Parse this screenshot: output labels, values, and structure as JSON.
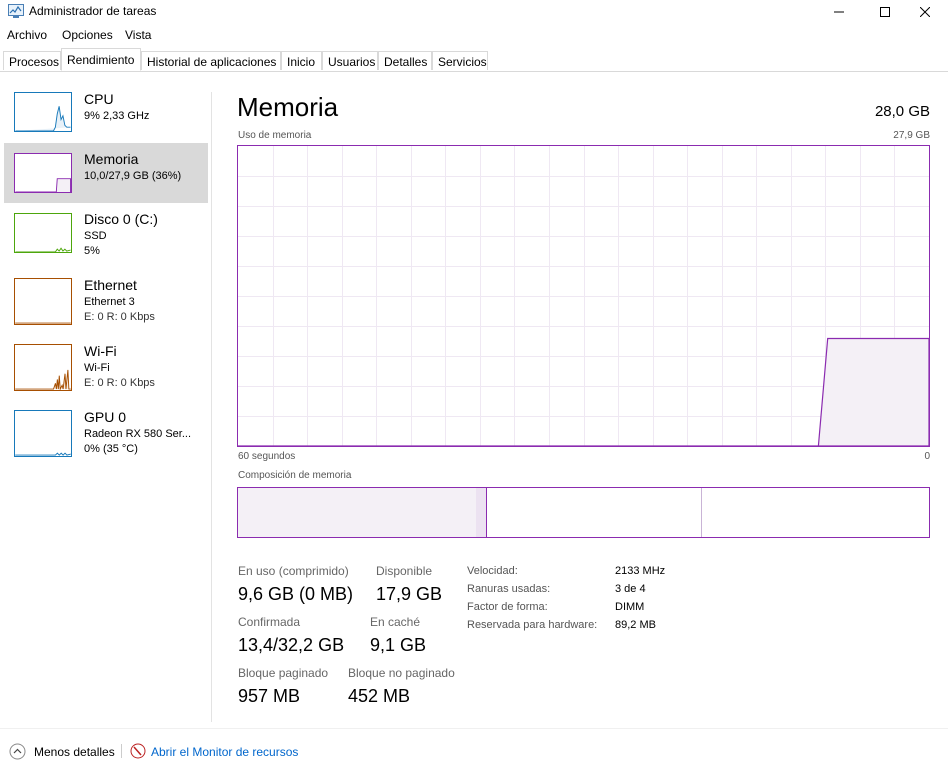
{
  "window": {
    "title": "Administrador de tareas"
  },
  "menu": [
    "Archivo",
    "Opciones",
    "Vista"
  ],
  "tabs": [
    "Procesos",
    "Rendimiento",
    "Historial de aplicaciones",
    "Inicio",
    "Usuarios",
    "Detalles",
    "Servicios"
  ],
  "active_tab": "Rendimiento",
  "sidebar": {
    "items": [
      {
        "name": "CPU",
        "sub1": "9%  2,33 GHz",
        "sub2": ""
      },
      {
        "name": "Memoria",
        "sub1": "10,0/27,9 GB (36%)",
        "sub2": ""
      },
      {
        "name": "Disco 0 (C:)",
        "sub1": "SSD",
        "sub2": "5%"
      },
      {
        "name": "Ethernet",
        "sub1": "Ethernet 3",
        "sub2": "E: 0  R: 0 Kbps"
      },
      {
        "name": "Wi-Fi",
        "sub1": "Wi-Fi",
        "sub2": "E: 0  R: 0 Kbps"
      },
      {
        "name": "GPU 0",
        "sub1": "Radeon RX 580 Ser...",
        "sub2": "0% (35 °C)"
      }
    ]
  },
  "main": {
    "title": "Memoria",
    "total": "28,0 GB",
    "graph_label": "Uso de memoria",
    "graph_max": "27,9 GB",
    "time_left": "60 segundos",
    "time_right": "0",
    "composition_label": "Composición de memoria"
  },
  "stats": {
    "in_use_label": "En uso (comprimido)",
    "in_use_value": "9,6 GB (0 MB)",
    "available_label": "Disponible",
    "available_value": "17,9 GB",
    "committed_label": "Confirmada",
    "committed_value": "13,4/32,2 GB",
    "cached_label": "En caché",
    "cached_value": "9,1 GB",
    "paged_label": "Bloque paginado",
    "paged_value": "957 MB",
    "nonpaged_label": "Bloque no paginado",
    "nonpaged_value": "452 MB"
  },
  "details": {
    "speed_label": "Velocidad:",
    "speed_value": "2133 MHz",
    "slots_label": "Ranuras usadas:",
    "slots_value": "3 de 4",
    "form_label": "Factor de forma:",
    "form_value": "DIMM",
    "reserved_label": "Reservada para hardware:",
    "reserved_value": "89,2 MB"
  },
  "footer": {
    "less_details": "Menos detalles",
    "resource_monitor": "Abrir el Monitor de recursos"
  },
  "colors": {
    "memory": "#8b2bb0",
    "memory_fill": "#f4f0f6",
    "cpu": "#1779ba",
    "disk": "#4da60c",
    "ethernet": "#a74f01",
    "gpu": "#1779ba",
    "link": "#0066cc"
  },
  "chart_data": {
    "type": "area",
    "title": "Uso de memoria",
    "xlabel": "",
    "ylabel": "",
    "xlim": [
      60,
      0
    ],
    "ylim": [
      0,
      27.9
    ],
    "grid": true,
    "series": [
      {
        "name": "",
        "x": [
          60,
          9.6,
          8.8,
          6.5,
          0
        ],
        "y": [
          0,
          0,
          10.0,
          10.0,
          10.0
        ]
      }
    ]
  }
}
